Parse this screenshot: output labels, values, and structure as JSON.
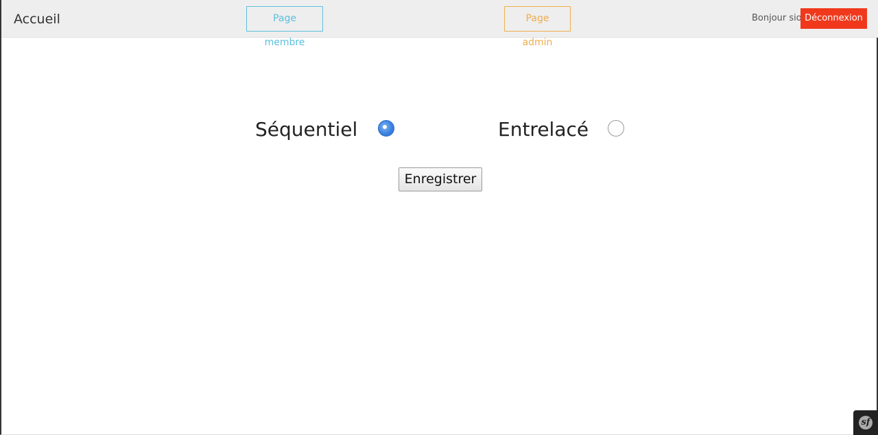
{
  "navbar": {
    "brand": "Accueil",
    "member_page_label": "Page membre",
    "admin_page_label": "Page admin",
    "greeting": "Bonjour sio",
    "logout_label": "Déconnexion"
  },
  "form": {
    "options": [
      {
        "label": "Séquentiel",
        "checked": true
      },
      {
        "label": "Entrelacé",
        "checked": false
      }
    ],
    "save_label": "Enregistrer"
  },
  "colors": {
    "member_outline": "#5bc0de",
    "admin_outline": "#f0ad4e",
    "logout_bg": "#f0381c",
    "radio_checked": "#3b82e0"
  },
  "icons": {
    "debug_toolbar": "symfony-logo-icon"
  }
}
